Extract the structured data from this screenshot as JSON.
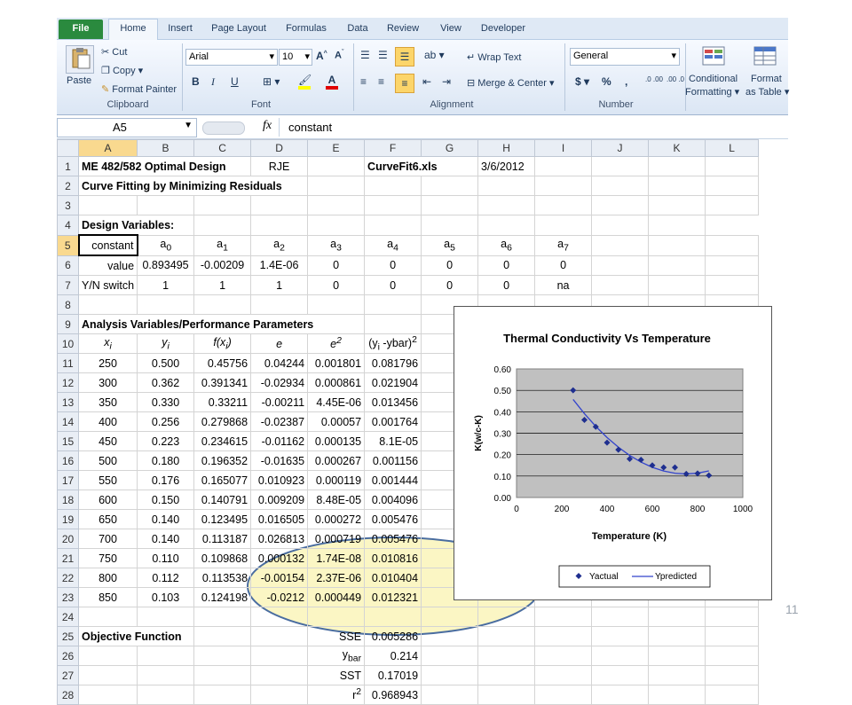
{
  "tabs": [
    "File",
    "Home",
    "Insert",
    "Page Layout",
    "Formulas",
    "Data",
    "Review",
    "View",
    "Developer"
  ],
  "clipboard": {
    "paste": "Paste",
    "cut": "Cut",
    "copy": "Copy",
    "format_painter": "Format Painter",
    "label": "Clipboard"
  },
  "font": {
    "name": "Arial",
    "size": "10",
    "bold": "B",
    "italic": "I",
    "underline": "U",
    "label": "Font"
  },
  "alignment": {
    "wrap_text": "Wrap Text",
    "merge_center": "Merge & Center",
    "label": "Alignment"
  },
  "number": {
    "format": "General",
    "currency": "$",
    "percent": "%",
    "comma": ",",
    "inc_decimal": ".0 .00",
    "dec_decimal": ".00 .0",
    "label": "Number"
  },
  "styles": {
    "conditional": "Conditional",
    "conditional2": "Formatting",
    "format_as": "Format",
    "format_as2": "as Table"
  },
  "formula_bar": {
    "name_box": "A5",
    "fx": "fx",
    "content": "constant"
  },
  "columns": [
    "A",
    "B",
    "C",
    "D",
    "E",
    "F",
    "G",
    "H",
    "I",
    "J",
    "K",
    "L"
  ],
  "rows": {
    "r1": {
      "a": "ME 482/582 Optimal Design",
      "d": "RJE",
      "f": "CurveFit6.xls",
      "h": "3/6/2012"
    },
    "r2": {
      "a": "Curve Fitting by Minimizing Residuals"
    },
    "r4": {
      "a": "Design Variables:"
    },
    "r5": {
      "a": "constant",
      "b": "a",
      "c": "a",
      "d": "a",
      "e": "a",
      "f": "a",
      "g": "a",
      "h": "a",
      "i": "a",
      "sb": "0",
      "sc": "1",
      "sd": "2",
      "se": "3",
      "sf": "4",
      "sg": "5",
      "sh": "6",
      "si": "7"
    },
    "r6": {
      "a": "value",
      "b": "0.893495",
      "c": "-0.00209",
      "d": "1.4E-06",
      "e": "0",
      "f": "0",
      "g": "0",
      "h": "0",
      "i": "0"
    },
    "r7": {
      "a": "Y/N switch",
      "b": "1",
      "c": "1",
      "d": "1",
      "e": "0",
      "f": "0",
      "g": "0",
      "h": "0",
      "i": "na"
    },
    "r9": {
      "a": "Analysis Variables/Performance Parameters"
    },
    "r10": {
      "a": "x",
      "as": "i",
      "b": "y",
      "bs": "i",
      "c1": "f(x",
      "cs": "i",
      "c2": ")",
      "d": "e",
      "e": "e",
      "es": "2",
      "f1": "(y",
      "fs": "i",
      "f2": " -ybar)",
      "fs2": "2"
    },
    "r25": {
      "a": "Objective Function",
      "e": "SSE",
      "f": "0.005286"
    },
    "r26": {
      "e": "y",
      "es": "bar",
      "f": "0.214"
    },
    "r27": {
      "e": "SST",
      "f": "0.17019"
    },
    "r28": {
      "e": "r",
      "es": "2",
      "f": "0.968943"
    }
  },
  "data_rows": [
    [
      "250",
      "0.500",
      "0.45756",
      "0.04244",
      "0.001801",
      "0.081796"
    ],
    [
      "300",
      "0.362",
      "0.391341",
      "-0.02934",
      "0.000861",
      "0.021904"
    ],
    [
      "350",
      "0.330",
      "0.33211",
      "-0.00211",
      "4.45E-06",
      "0.013456"
    ],
    [
      "400",
      "0.256",
      "0.279868",
      "-0.02387",
      "0.00057",
      "0.001764"
    ],
    [
      "450",
      "0.223",
      "0.234615",
      "-0.01162",
      "0.000135",
      "8.1E-05"
    ],
    [
      "500",
      "0.180",
      "0.196352",
      "-0.01635",
      "0.000267",
      "0.001156"
    ],
    [
      "550",
      "0.176",
      "0.165077",
      "0.010923",
      "0.000119",
      "0.001444"
    ],
    [
      "600",
      "0.150",
      "0.140791",
      "0.009209",
      "8.48E-05",
      "0.004096"
    ],
    [
      "650",
      "0.140",
      "0.123495",
      "0.016505",
      "0.000272",
      "0.005476"
    ],
    [
      "700",
      "0.140",
      "0.113187",
      "0.026813",
      "0.000719",
      "0.005476"
    ],
    [
      "750",
      "0.110",
      "0.109868",
      "0.000132",
      "1.74E-08",
      "0.010816"
    ],
    [
      "800",
      "0.112",
      "0.113538",
      "-0.00154",
      "2.37E-06",
      "0.010404"
    ],
    [
      "850",
      "0.103",
      "0.124198",
      "-0.0212",
      "0.000449",
      "0.012321"
    ]
  ],
  "chart_data": {
    "type": "scatter",
    "title": "Thermal Conductivity Vs Temperature",
    "xlabel": "Temperature (K)",
    "ylabel": "K(w/c-K)",
    "xlim": [
      0,
      1000
    ],
    "ylim": [
      0,
      0.6
    ],
    "xticks": [
      "0",
      "200",
      "400",
      "600",
      "800",
      "1000"
    ],
    "yticks": [
      "0.00",
      "0.10",
      "0.20",
      "0.30",
      "0.40",
      "0.50",
      "0.60"
    ],
    "grid": true,
    "legend": "bottom",
    "x": [
      250,
      300,
      350,
      400,
      450,
      500,
      550,
      600,
      650,
      700,
      750,
      800,
      850
    ],
    "series": [
      {
        "name": "Yactual",
        "style": "markers",
        "color": "#1f2f8f",
        "values": [
          0.5,
          0.362,
          0.33,
          0.256,
          0.223,
          0.18,
          0.176,
          0.15,
          0.14,
          0.14,
          0.11,
          0.112,
          0.103
        ]
      },
      {
        "name": "Ypredicted",
        "style": "line",
        "color": "#3344cc",
        "values": [
          0.45756,
          0.391341,
          0.33211,
          0.279868,
          0.234615,
          0.196352,
          0.165077,
          0.140791,
          0.123495,
          0.113187,
          0.109868,
          0.113538,
          0.124198
        ]
      }
    ]
  },
  "page_number": "11",
  "colors": {
    "accent": "#2a8a3e",
    "highlight_ellipse": "#fbf6c4",
    "ellipse_border": "#4a6da0",
    "chart_plot_bg": "#c0c0c0"
  }
}
